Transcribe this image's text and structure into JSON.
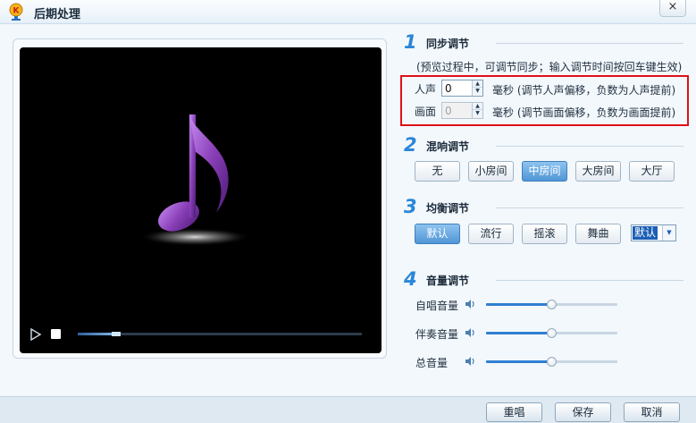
{
  "window": {
    "title": "后期处理",
    "close_glyph": "×"
  },
  "player": {
    "progress": 0.15,
    "icons": {
      "play": "play-icon",
      "stop": "stop-icon",
      "note": "music-note-icon"
    }
  },
  "sections": {
    "sync": {
      "number": "1",
      "title": "同步调节",
      "hint": "(预览过程中，可调节同步；输入调节时间按回车键生效)",
      "voice": {
        "label": "人声",
        "value": "0",
        "unit_desc": "毫秒 (调节人声偏移，负数为人声提前)"
      },
      "picture": {
        "label": "画面",
        "value": "0",
        "unit_desc": "毫秒 (调节画面偏移，负数为画面提前)",
        "disabled": true
      }
    },
    "reverb": {
      "number": "2",
      "title": "混响调节",
      "options": [
        "无",
        "小房间",
        "中房间",
        "大房间",
        "大厅"
      ],
      "selected": "中房间"
    },
    "eq": {
      "number": "3",
      "title": "均衡调节",
      "options": [
        "默认",
        "流行",
        "摇滚",
        "舞曲"
      ],
      "selected": "默认",
      "dropdown_value": "默认"
    },
    "volume": {
      "number": "4",
      "title": "音量调节",
      "sliders": [
        {
          "label": "自唱音量",
          "level": 0.5
        },
        {
          "label": "伴奏音量",
          "level": 0.5
        },
        {
          "label": "总音量",
          "level": 0.5
        }
      ]
    }
  },
  "footer": {
    "resing": "重唱",
    "save": "保存",
    "cancel": "取消"
  },
  "colors": {
    "accent": "#2a86d8",
    "selected_button": "#4f96d6",
    "highlight_box": "#e0101a",
    "note": "#8a3fb8"
  }
}
